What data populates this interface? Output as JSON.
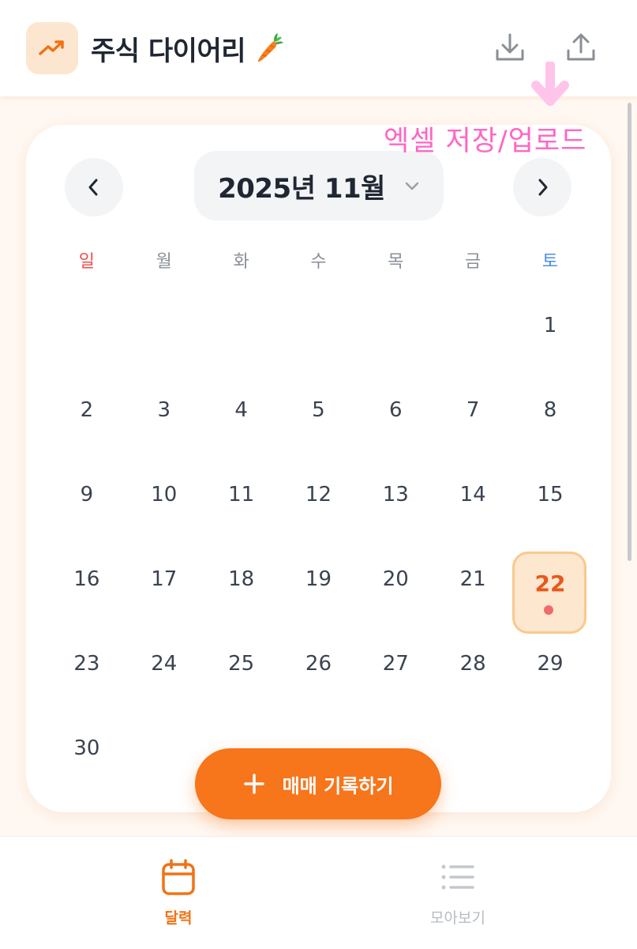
{
  "app": {
    "title": "주식 다이어리"
  },
  "annotation": {
    "text": "엑셀 저장/업로드"
  },
  "calendar": {
    "month_label": "2025년 11월",
    "weekdays": [
      "일",
      "월",
      "화",
      "수",
      "목",
      "금",
      "토"
    ],
    "weeks": [
      [
        "",
        "",
        "",
        "",
        "",
        "",
        "1"
      ],
      [
        "2",
        "3",
        "4",
        "5",
        "6",
        "7",
        "8"
      ],
      [
        "9",
        "10",
        "11",
        "12",
        "13",
        "14",
        "15"
      ],
      [
        "16",
        "17",
        "18",
        "19",
        "20",
        "21",
        "22"
      ],
      [
        "23",
        "24",
        "25",
        "26",
        "27",
        "28",
        "29"
      ],
      [
        "30",
        "",
        "",
        "",
        "",
        "",
        ""
      ]
    ],
    "selected_day": "22"
  },
  "fab": {
    "label": "매매 기록하기"
  },
  "bottom_nav": {
    "calendar_label": "달력",
    "collect_label": "모아보기"
  },
  "colors": {
    "accent": "#f7751b",
    "sunday": "#ef4e4e",
    "saturday": "#4b8ee8",
    "annotation": "#ff66c4"
  },
  "icons": {
    "logo": "trending-up-icon",
    "download": "download-icon",
    "upload": "upload-icon",
    "prev": "chevron-left-icon",
    "next": "chevron-right-icon",
    "dropdown": "chevron-down-icon",
    "add": "plus-icon",
    "calendar": "calendar-icon",
    "list": "list-icon"
  }
}
